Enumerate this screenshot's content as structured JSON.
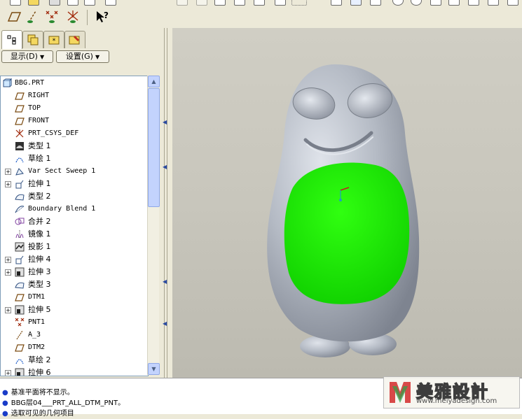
{
  "toolbar": {
    "icons_row1": [
      "new-icon",
      "open-icon",
      "save-icon",
      "print-icon",
      "undo-icon",
      "redo-icon",
      "cut-icon",
      "copy-icon",
      "paste-icon",
      "regenerate-icon",
      "find-icon",
      "select-icon",
      "repaint-icon",
      "zoom-in-icon",
      "zoom-out-icon",
      "refit-icon",
      "orient-icon",
      "saved-views-icon",
      "layers-icon"
    ],
    "icons_row2": [
      "datum-planes-toggle-icon",
      "datum-axes-toggle-icon",
      "datum-points-toggle-icon",
      "coordinate-systems-toggle-icon",
      "context-help-icon"
    ],
    "help_label": "?"
  },
  "panel": {
    "tabs": [
      "model-tree-tab",
      "folder-browser-tab",
      "favorites-tab",
      "connections-tab"
    ],
    "show_menu": "显示(D)",
    "settings_menu": "设置(G)"
  },
  "tree": {
    "root": "BBG.PRT",
    "items": [
      {
        "label": "RIGHT",
        "icon": "datum-plane-icon",
        "expand": false
      },
      {
        "label": "TOP",
        "icon": "datum-plane-icon",
        "expand": false
      },
      {
        "label": "FRONT",
        "icon": "datum-plane-icon",
        "expand": false
      },
      {
        "label": "PRT_CSYS_DEF",
        "icon": "csys-icon",
        "expand": false
      },
      {
        "label": "类型 1",
        "icon": "solid-feature-icon",
        "expand": false
      },
      {
        "label": "草绘 1",
        "icon": "sketch-icon",
        "expand": false
      },
      {
        "label": "Var Sect Sweep 1",
        "icon": "sweep-icon",
        "expand": true
      },
      {
        "label": "拉伸 1",
        "icon": "extrude-icon",
        "expand": true
      },
      {
        "label": "类型 2",
        "icon": "surface-icon",
        "expand": false
      },
      {
        "label": "Boundary Blend 1",
        "icon": "boundary-blend-icon",
        "expand": false
      },
      {
        "label": "合并 2",
        "icon": "merge-icon",
        "expand": false
      },
      {
        "label": "镜像 1",
        "icon": "mirror-icon",
        "expand": false
      },
      {
        "label": "投影 1",
        "icon": "project-icon",
        "expand": false
      },
      {
        "label": "拉伸 4",
        "icon": "extrude-icon",
        "expand": true
      },
      {
        "label": "拉伸 3",
        "icon": "extrude-cut-icon",
        "expand": true
      },
      {
        "label": "类型 3",
        "icon": "surface-icon",
        "expand": false
      },
      {
        "label": "DTM1",
        "icon": "datum-plane-icon",
        "expand": false
      },
      {
        "label": "拉伸 5",
        "icon": "extrude-cut-icon",
        "expand": true
      },
      {
        "label": "PNT1",
        "icon": "datum-point-icon",
        "expand": false
      },
      {
        "label": "A_3",
        "icon": "datum-axis-icon",
        "expand": false
      },
      {
        "label": "DTM2",
        "icon": "datum-plane-icon",
        "expand": false
      },
      {
        "label": "草绘 2",
        "icon": "sketch-icon",
        "expand": false
      },
      {
        "label": "拉伸 6",
        "icon": "extrude-cut-icon",
        "expand": true
      }
    ]
  },
  "messages": [
    "基准平面将不显示。",
    "BBG层04___PRT_ALL_DTM_PNT。",
    "选取可见的几何项目"
  ],
  "watermark": {
    "name": "美雅設計",
    "url": "www.meiyadesign.com"
  },
  "colors": {
    "model_body": "#aab0ba",
    "belly_highlight": "#22ee00",
    "viewport_bg": "#c8c6bc"
  }
}
